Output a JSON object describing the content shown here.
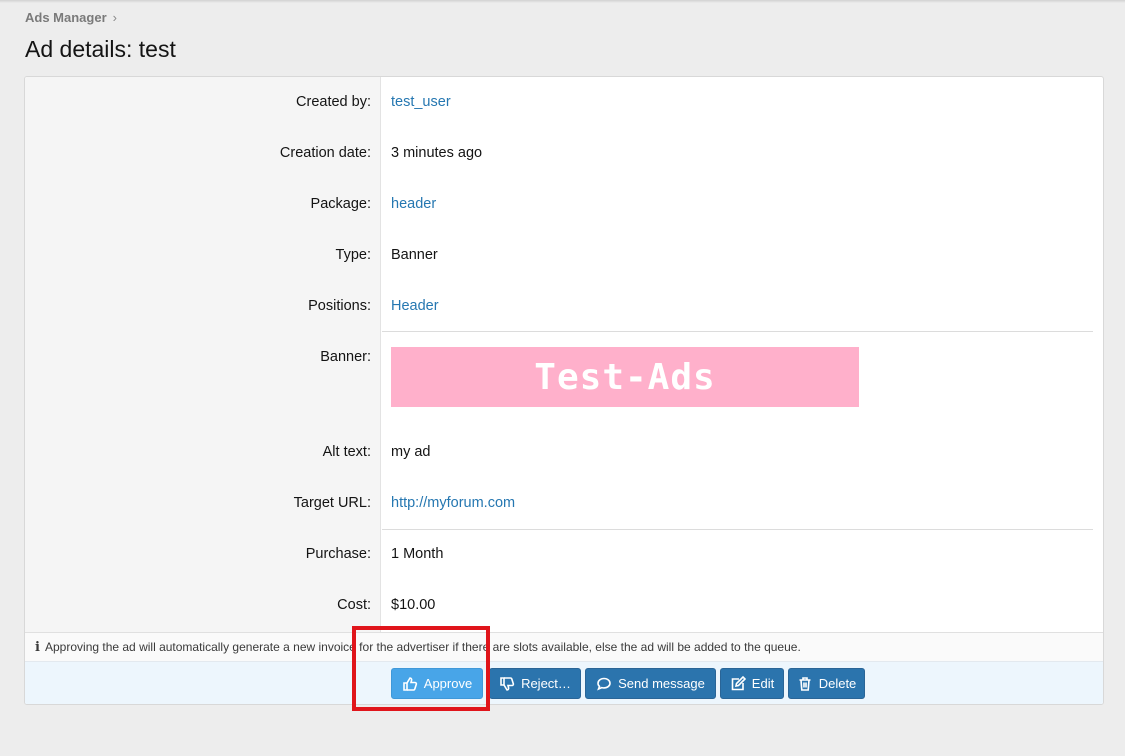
{
  "breadcrumb": {
    "label": "Ads Manager",
    "separator": "›"
  },
  "page": {
    "title": "Ad details: test"
  },
  "details": [
    {
      "label": "Created by:",
      "value": "test_user",
      "link": true
    },
    {
      "label": "Creation date:",
      "value": "3 minutes ago",
      "link": false
    },
    {
      "label": "Package:",
      "value": "header",
      "link": true
    },
    {
      "label": "Type:",
      "value": "Banner",
      "link": false
    },
    {
      "label": "Positions:",
      "value": "Header",
      "link": true
    },
    {
      "label": "Banner:",
      "value": "",
      "link": false
    },
    {
      "label": "Alt text:",
      "value": "my ad",
      "link": false
    },
    {
      "label": "Target URL:",
      "value": "http://myforum.com",
      "link": true
    },
    {
      "label": "Purchase:",
      "value": "1 Month",
      "link": false
    },
    {
      "label": "Cost:",
      "value": "$10.00",
      "link": false
    }
  ],
  "banner": {
    "text": "Test-Ads",
    "background": "#ffb0cb"
  },
  "note": {
    "icon": "info-icon",
    "text": "Approving the ad will automatically generate a new invoice for the advertiser if there are slots available, else the ad will be added to the queue."
  },
  "actions": {
    "approve": "Approve",
    "reject": "Reject…",
    "send_message": "Send message",
    "edit": "Edit",
    "delete": "Delete"
  },
  "colors": {
    "link": "#2577b1",
    "button": "#2b74ad",
    "approve_button": "#48a5e8",
    "highlight": "#e0151b"
  }
}
